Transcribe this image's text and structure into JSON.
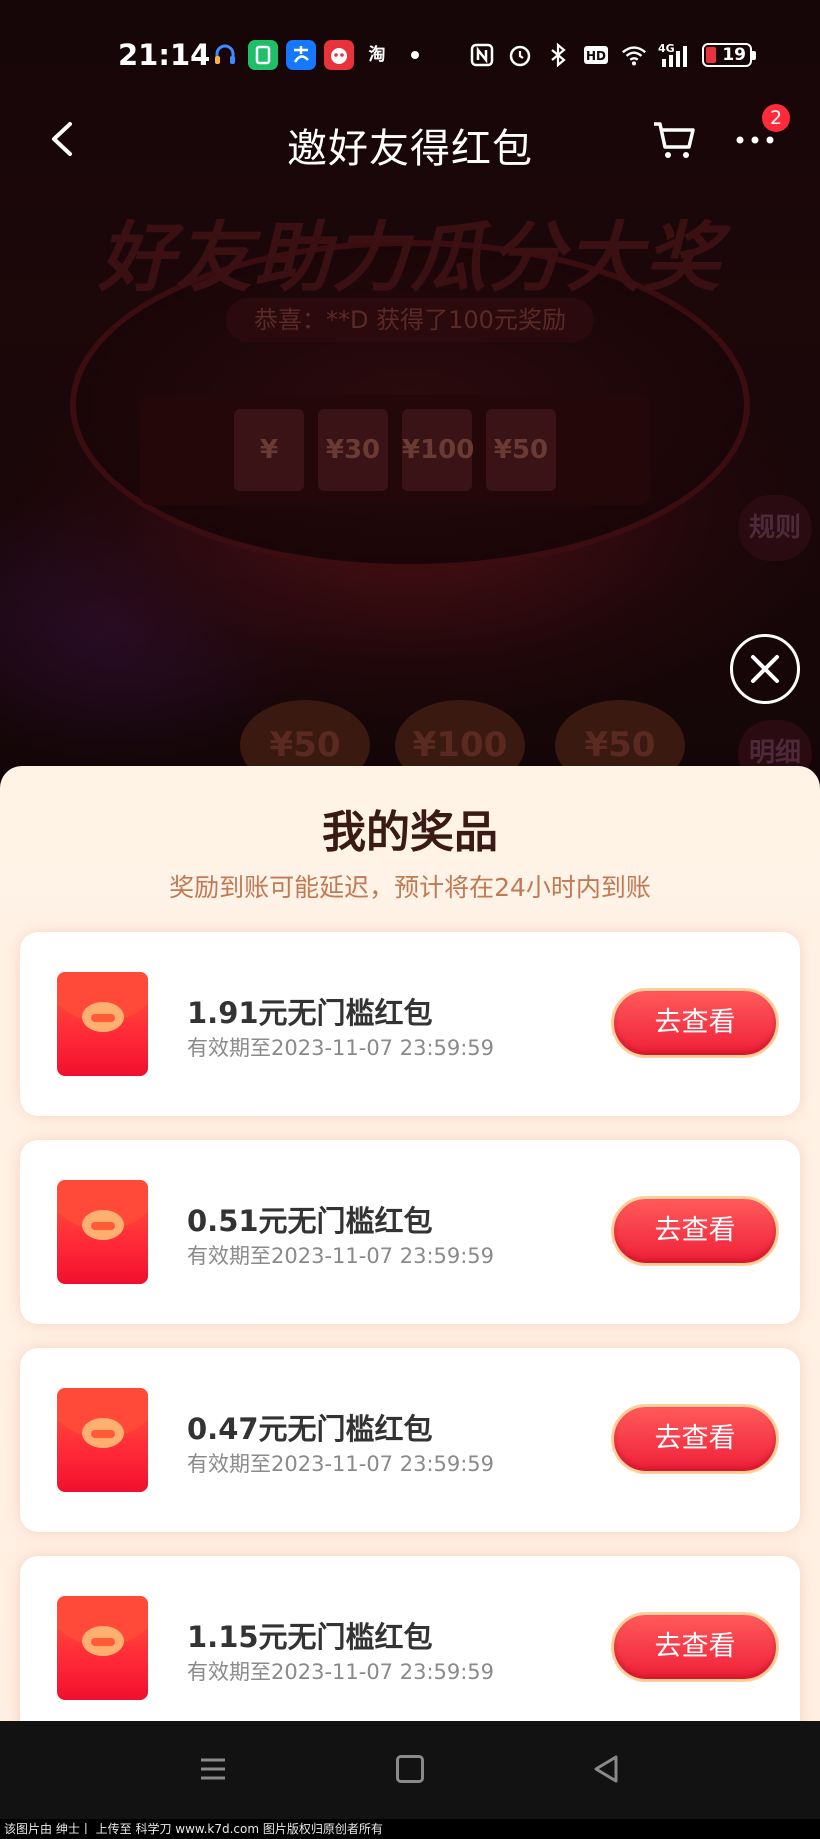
{
  "status_bar": {
    "time": "21:14",
    "taobao_glyph": "淘",
    "network": "4G",
    "battery": "19"
  },
  "nav": {
    "title": "邀好友得红包",
    "cart_badge_count": "2"
  },
  "background": {
    "banner": "好友助力瓜分大奖",
    "congrats": "恭喜：**D 获得了100元奖励",
    "tiles": [
      "¥",
      "¥30",
      "¥100",
      "¥50"
    ],
    "side_rules": "规则",
    "side_details": "明细",
    "coupons": [
      "¥50",
      "¥100",
      "¥50"
    ]
  },
  "panel": {
    "title": "我的奖品",
    "subtitle": "奖励到账可能延迟，预计将在24小时内到账",
    "prizes": [
      {
        "name": "1.91元无门槛红包",
        "expiry": "有效期至2023-11-07 23:59:59",
        "button": "去查看"
      },
      {
        "name": "0.51元无门槛红包",
        "expiry": "有效期至2023-11-07 23:59:59",
        "button": "去查看"
      },
      {
        "name": "0.47元无门槛红包",
        "expiry": "有效期至2023-11-07 23:59:59",
        "button": "去查看"
      },
      {
        "name": "1.15元无门槛红包",
        "expiry": "有效期至2023-11-07 23:59:59",
        "button": "去查看"
      }
    ]
  },
  "watermark": "该图片由 绅士丨 上传至 科学刀 www.k7d.com 图片版权归原创者所有",
  "colors": {
    "accent_red": "#f0203a",
    "panel_bg": "#fff3e6",
    "subtitle": "#c07a55"
  },
  "icons": [
    "back-arrow-icon",
    "cart-icon",
    "more-icon",
    "close-icon",
    "menu-icon",
    "home-icon",
    "back-triangle-icon"
  ]
}
